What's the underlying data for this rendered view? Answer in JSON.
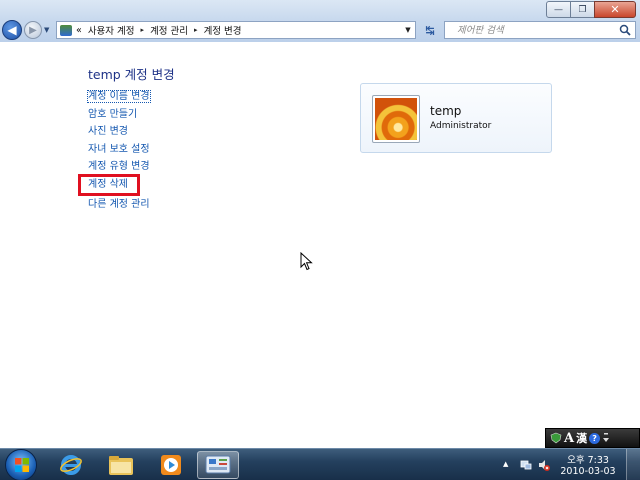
{
  "window": {
    "controls": {
      "minimize": "—",
      "maximize": "❐",
      "close": "✕"
    }
  },
  "address_bar": {
    "overflow": "«",
    "breadcrumbs": [
      "사용자 계정",
      "계정 관리",
      "계정 변경"
    ],
    "separator": "▸",
    "dropdown": "▼",
    "refresh": "↹"
  },
  "search": {
    "placeholder": "제어판 검색"
  },
  "nav": {
    "back": "◀",
    "forward": "▶",
    "history": "▼"
  },
  "main": {
    "title": "temp 계정 변경",
    "tasks": [
      {
        "label": "계정 이름 변경"
      },
      {
        "label": "암호 만들기"
      },
      {
        "label": "사진 변경"
      },
      {
        "label": "자녀 보호 설정"
      },
      {
        "label": "계정 유형 변경"
      },
      {
        "label": "계정 삭제"
      }
    ],
    "other_task": "다른 계정 관리"
  },
  "account": {
    "name": "temp",
    "type": "Administrator",
    "picture": "orange-flower-picture"
  },
  "ime_bar": {
    "mode": "A",
    "hanja": "漢",
    "help": "?"
  },
  "taskbar": {
    "apps": [
      "internet-explorer-icon",
      "file-explorer-icon",
      "media-player-icon",
      "control-panel-icon"
    ],
    "tray_expand": "▲",
    "clock": {
      "time": "오후 7:33",
      "date": "2010-03-03"
    }
  },
  "colors": {
    "link": "#1558b0",
    "title": "#1e3287",
    "highlight_box": "#e01020"
  }
}
